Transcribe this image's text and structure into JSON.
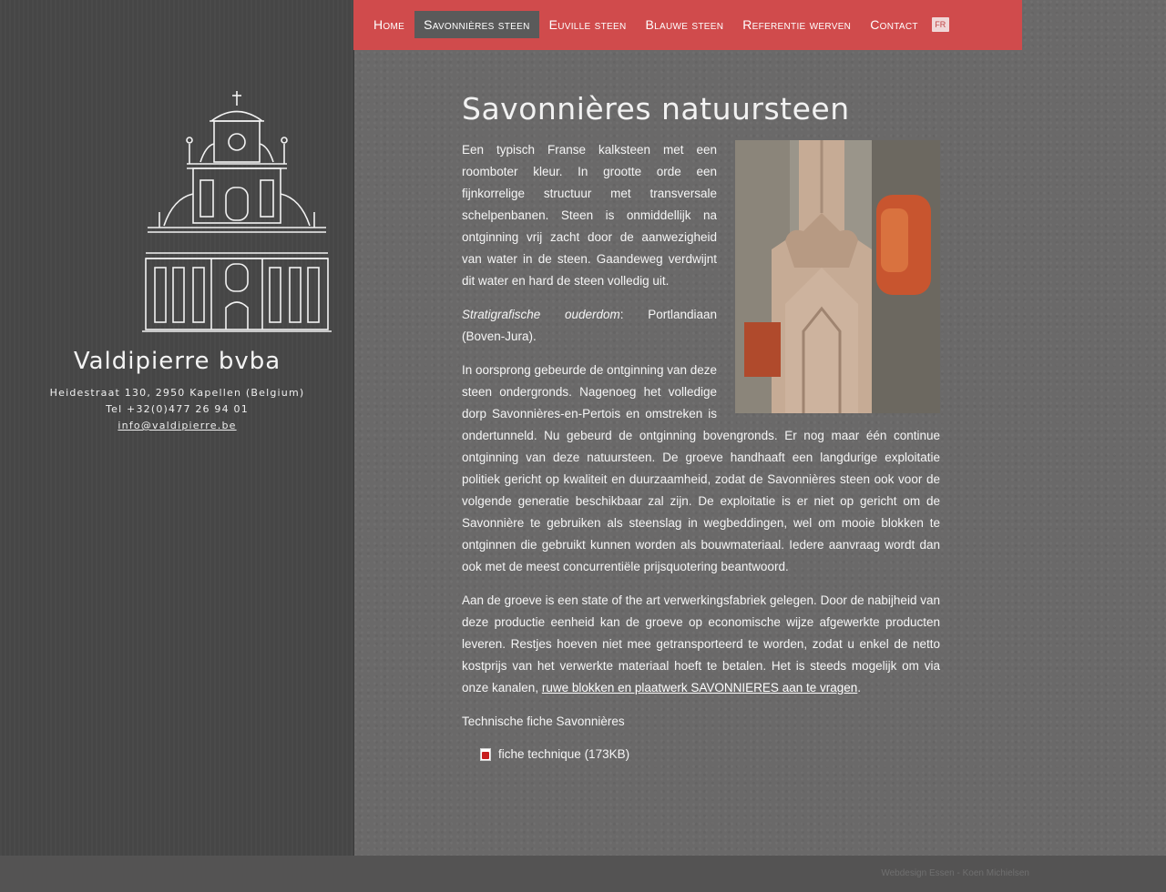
{
  "nav": {
    "items": [
      {
        "label": "Home"
      },
      {
        "label": "Savonnières steen"
      },
      {
        "label": "Euville steen"
      },
      {
        "label": "Blauwe steen"
      },
      {
        "label": "Referentie werven"
      },
      {
        "label": "Contact"
      }
    ],
    "active_index": 1,
    "lang_label": "FR"
  },
  "sidebar": {
    "company_name": "Valdipierre bvba",
    "address": "Heidestraat 130, 2950 Kapellen (Belgium)",
    "phone": "Tel +32(0)477 26 94 01",
    "email": "info@valdipierre.be"
  },
  "content": {
    "title": "Savonnières natuursteen",
    "para1": "Een typisch Franse kalksteen met een roomboter kleur. In grootte orde een fijnkorrelige structuur met transversale schelpenbanen. Steen is onmiddellijk na ontginning vrij zacht door de aanwezigheid van water in de steen. Gaandeweg verdwijnt dit water en hard de steen volledig uit.",
    "para2_label": "Stratigrafische ouderdom",
    "para2_value": ": Portlandiaan (Boven-Jura).",
    "para3": "In oorsprong gebeurde de ontginning van deze steen ondergronds. Nagenoeg het volledige dorp Savonnières-en-Pertois en omstreken is ondertunneld. Nu gebeurd de ontginning bovengronds. Er nog maar één continue ontginning van deze natuursteen. De groeve handhaaft een langdurige exploitatie politiek gericht op kwaliteit en duurzaamheid, zodat de Savonnières steen ook voor de volgende generatie beschikbaar zal zijn. De exploitatie is er niet op gericht om de Savonnière te gebruiken als steenslag in wegbeddingen, wel om mooie blokken te ontginnen die gebruikt kunnen worden als bouwmateriaal. Iedere aanvraag wordt dan ook met de meest concurrentiële prijsquotering beantwoord.",
    "para4": "Aan de groeve is een state of the art verwerkingsfabriek gelegen. Door de nabijheid van deze productie eenheid kan de groeve op economische wijze afgewerkte producten leveren. Restjes hoeven niet mee getransporteerd te worden, zodat u enkel de netto kostprijs van het verwerkte materiaal hoeft te betalen. Het is steeds mogelijk om via onze kanalen, ",
    "para4_link": "ruwe blokken en plaatwerk SAVONNIERES aan te vragen",
    "para4_end": ".",
    "tech_label": "Technische fiche Savonnières",
    "file_label": "fiche technique (173KB)"
  },
  "footer": {
    "credit": "Webdesign Essen - Koen Michielsen"
  }
}
